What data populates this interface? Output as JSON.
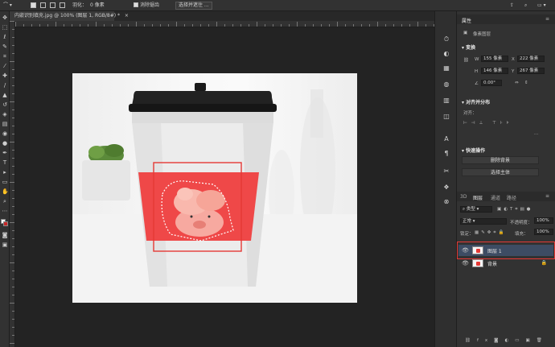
{
  "options_bar": {
    "feather_label": "羽化：",
    "feather_value": "0 像素",
    "antialias_label": "消除锯齿",
    "select_mask_button": "选择并遮住 ..."
  },
  "doc_tab": {
    "title": "内嵌识别填充.jpg @ 100% (图层 1, RGB/8#) *",
    "close": "×"
  },
  "properties_panel": {
    "tab": "属性",
    "pixel_layer": "像素图层",
    "transform_title": "变换",
    "w_label": "W",
    "w_value": "155 像素",
    "x_label": "X",
    "x_value": "222 像素",
    "h_label": "H",
    "h_value": "146 像素",
    "y_label": "Y",
    "y_value": "267 像素",
    "angle_value": "0.00°",
    "align_title": "对齐并分布",
    "align_to": "对齐：",
    "quick_actions_title": "快速操作",
    "remove_bg_button": "删除背景",
    "select_subject_button": "选择主体"
  },
  "layers_panel": {
    "tabs": [
      "3D",
      "图层",
      "通道",
      "路径"
    ],
    "kind_filter": "类型",
    "blend_mode": "正常",
    "opacity_label": "不透明度：",
    "opacity_value": "100%",
    "lock_label": "锁定：",
    "fill_label": "填充：",
    "fill_value": "100%",
    "layers": [
      {
        "name": "图层 1",
        "selected": true
      },
      {
        "name": "背景",
        "selected": false
      }
    ]
  },
  "colors": {
    "sleeve": "#ef4848",
    "highlight": "#e53935",
    "selected_layer": "#3d4c63"
  }
}
